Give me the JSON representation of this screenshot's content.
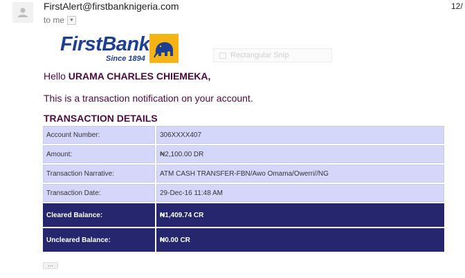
{
  "email": {
    "sender": "FirstAlert@firstbanknigeria.com",
    "date_partial": "12/",
    "recipient_line": "to me",
    "recipient_dropdown_icon": "chevron-down-icon"
  },
  "logo": {
    "brand": "FirstBank",
    "since": "Since 1894",
    "emblem_icon": "elephant-icon",
    "brand_color": "#1d3f91",
    "emblem_color": "#f6b315"
  },
  "overlay": {
    "snip_label": "Rectangular Snip"
  },
  "body": {
    "greeting_prefix": "Hello",
    "customer_name": "URAMA CHARLES CHIEMEKA,",
    "notice": "This is a transaction notification on your account.",
    "details_title": "TRANSACTION DETAILS"
  },
  "transaction": {
    "rows": [
      {
        "label": "Account Number:",
        "value": "306XXXX407"
      },
      {
        "label": "Amount:",
        "value": "₦2,100.00 DR"
      },
      {
        "label": "Transaction Narrative:",
        "value": "ATM CASH TRANSFER-FBN/Awo Omama/Owerri//NG"
      },
      {
        "label": "Transaction Date:",
        "value": "29-Dec-16 11:48 AM"
      },
      {
        "label": "Cleared Balance:",
        "value": "₦1,409.74 CR"
      },
      {
        "label": "Uncleared Balance:",
        "value": "₦0.00 CR"
      }
    ]
  },
  "footer": {
    "show_trimmed_label": "..."
  },
  "colors": {
    "text_purple": "#4b0b3e",
    "row_light": "#d5d7fa",
    "row_dark": "#25266e"
  }
}
